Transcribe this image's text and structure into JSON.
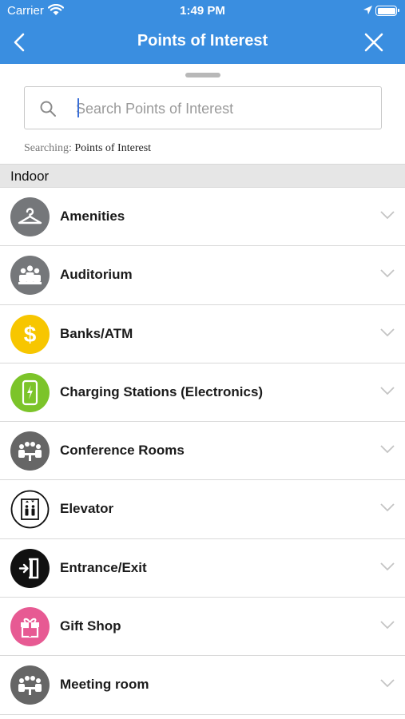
{
  "status_bar": {
    "carrier": "Carrier",
    "time": "1:49 PM"
  },
  "header": {
    "title": "Points of Interest",
    "back_icon": "chevron-left-icon",
    "close_icon": "close-icon"
  },
  "search": {
    "placeholder": "Search Points of Interest",
    "value": ""
  },
  "scope": {
    "prefix": "Searching:",
    "target": "Points of Interest"
  },
  "section": {
    "title": "Indoor"
  },
  "colors": {
    "header_bg": "#3a8ee0",
    "gray_icon": "#75777a",
    "yellow_icon": "#f7c600",
    "green_icon": "#7cc42a",
    "pink_icon": "#e75a93",
    "black_icon": "#111111"
  },
  "items": [
    {
      "label": "Amenities",
      "icon": "hanger-icon",
      "color": "#75777a"
    },
    {
      "label": "Auditorium",
      "icon": "audience-icon",
      "color": "#75777a"
    },
    {
      "label": "Banks/ATM",
      "icon": "dollar-icon",
      "color": "#f7c600"
    },
    {
      "label": "Charging Stations (Electronics)",
      "icon": "phone-charging-icon",
      "color": "#7cc42a"
    },
    {
      "label": "Conference Rooms",
      "icon": "meeting-table-icon",
      "color": "#666666"
    },
    {
      "label": "Elevator",
      "icon": "elevator-icon",
      "color": "#ffffff"
    },
    {
      "label": "Entrance/Exit",
      "icon": "exit-door-icon",
      "color": "#111111"
    },
    {
      "label": "Gift Shop",
      "icon": "gift-icon",
      "color": "#e75a93"
    },
    {
      "label": "Meeting room",
      "icon": "meeting-table-icon",
      "color": "#666666"
    }
  ]
}
